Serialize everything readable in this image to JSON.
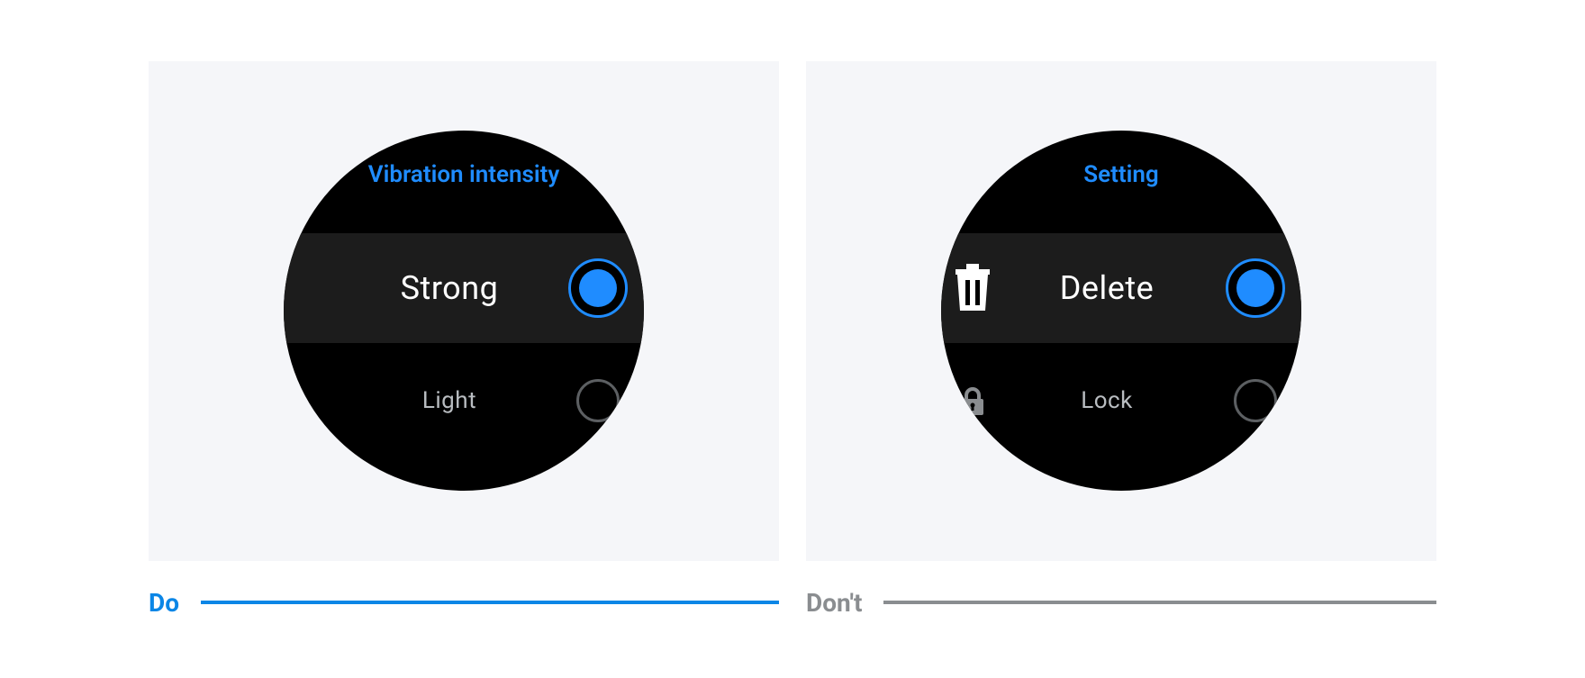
{
  "colors": {
    "accent": "#1f8cff",
    "panel_bg": "#f5f6f9",
    "do": "#0b86e6",
    "dont": "#8a8d90"
  },
  "do_example": {
    "caption": "Do",
    "header": "Vibration intensity",
    "options": [
      {
        "label": "Strong",
        "selected": true
      },
      {
        "label": "Light",
        "selected": false
      }
    ]
  },
  "dont_example": {
    "caption": "Don't",
    "header": "Setting",
    "options": [
      {
        "label": "Delete",
        "icon": "trash-icon",
        "selected": true
      },
      {
        "label": "Lock",
        "icon": "lock-icon",
        "selected": false
      }
    ]
  }
}
